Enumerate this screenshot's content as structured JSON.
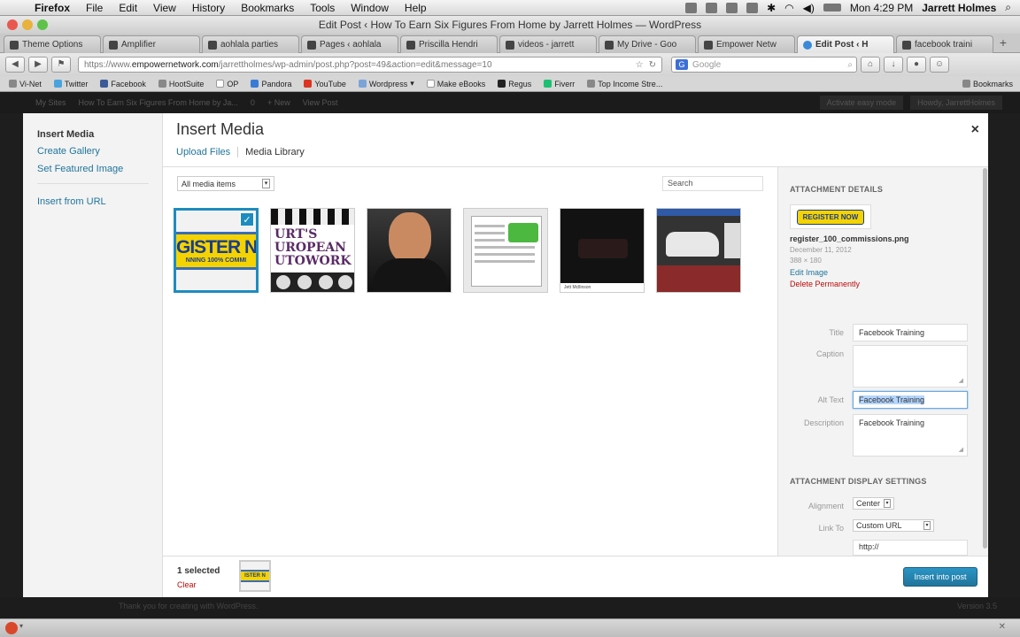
{
  "menubar": {
    "app": "Firefox",
    "items": [
      "File",
      "Edit",
      "View",
      "History",
      "Bookmarks",
      "Tools",
      "Window",
      "Help"
    ],
    "clock": "Mon 4:29 PM",
    "user": "Jarrett Holmes"
  },
  "window": {
    "title": "Edit Post ‹ How To Earn Six Figures From Home by Jarrett Holmes — WordPress"
  },
  "tabs": [
    {
      "label": "Theme Options"
    },
    {
      "label": "Amplifier"
    },
    {
      "label": "aohlala parties"
    },
    {
      "label": "Pages ‹ aohlala"
    },
    {
      "label": "Priscilla Hendri"
    },
    {
      "label": "videos - jarrett"
    },
    {
      "label": "My Drive - Goo"
    },
    {
      "label": "Empower Netw"
    },
    {
      "label": "Edit Post ‹ H"
    },
    {
      "label": "facebook traini"
    }
  ],
  "nav": {
    "url_prefix": "https://www.",
    "url_domain": "empowernetwork.com",
    "url_rest": "/jarrettholmes/wp-admin/post.php?post=49&action=edit&message=10",
    "search_placeholder": "Google",
    "search_engine": "G"
  },
  "bookmarks": [
    "Vi-Net",
    "Twitter",
    "Facebook",
    "HootSuite",
    "OP",
    "Pandora",
    "YouTube",
    "Wordpress",
    "Make eBooks",
    "Regus",
    "Fiverr",
    "Top Income Stre..."
  ],
  "bookmarks_menu": "Bookmarks",
  "wpbar": {
    "items": [
      "My Sites",
      "How To Earn Six Figures From Home by Ja...",
      "0",
      "+ New",
      "View Post"
    ],
    "right": [
      "Activate easy mode",
      "Howdy, JarrettHolmes"
    ]
  },
  "sidebar": {
    "title": "Insert Media",
    "links": [
      "Create Gallery",
      "Set Featured Image"
    ],
    "url_link": "Insert from URL"
  },
  "modal": {
    "title": "Insert Media",
    "close": "×",
    "tabs": [
      "Upload Files",
      "Media Library"
    ]
  },
  "library": {
    "filter": "All media items",
    "search_placeholder": "Search",
    "thumb1_text": "GISTER NO",
    "thumb1_small": "NNING 100% COMMI",
    "thumb2_text": "URT'S\nUROPEAN\nUTOWORK",
    "thumb5_caption": "Jett Mcllinson"
  },
  "details": {
    "heading": "Attachment Details",
    "thumb_text": "REGISTER NOW",
    "filename": "register_100_commissions.png",
    "date": "December 11, 2012",
    "dimensions": "388 × 180",
    "edit_link": "Edit Image",
    "delete_link": "Delete Permanently",
    "title_label": "Title",
    "title_value": "Facebook Training",
    "caption_label": "Caption",
    "caption_value": "",
    "alt_label": "Alt Text",
    "alt_value": "Facebook Training",
    "description_label": "Description",
    "description_value": "Facebook Training",
    "display_heading": "Attachment Display Settings",
    "alignment_label": "Alignment",
    "alignment_value": "Center",
    "link_label": "Link To",
    "link_value": "Custom URL",
    "url_value": "http://"
  },
  "toolbar": {
    "selected": "1 selected",
    "clear": "Clear",
    "mini_thumb_text": "ISTER N",
    "insert_button": "Insert into post"
  },
  "footer": {
    "thanks": "Thank you for creating with WordPress.",
    "version": "Version 3.5"
  },
  "colors": {
    "accent": "#21759b",
    "delete": "#bc0b0b",
    "selected_border": "#1e8cbe"
  }
}
